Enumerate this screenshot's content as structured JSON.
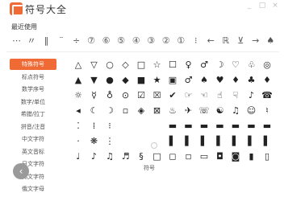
{
  "window": {
    "title": "符号大全",
    "controls": [
      "_",
      "□",
      "×"
    ]
  },
  "recent": {
    "title": "最近使用",
    "symbols": [
      "⋯",
      "〃",
      "‖",
      "¨",
      "÷",
      "⑦",
      "⑥",
      "⑤",
      "④",
      "③",
      "②",
      "①",
      "⁝",
      "←",
      "ℝ",
      "⊻",
      "→",
      "♠"
    ]
  },
  "sidebar": {
    "items": [
      {
        "label": "特殊符号",
        "active": true
      },
      {
        "label": "标点符号",
        "active": false
      },
      {
        "label": "数学序号",
        "active": false
      },
      {
        "label": "数字/单位",
        "active": false
      },
      {
        "label": "希腊/拉丁",
        "active": false
      },
      {
        "label": "拼音/注音",
        "active": false
      },
      {
        "label": "中文字符",
        "active": false
      },
      {
        "label": "英文音标",
        "active": false
      },
      {
        "label": "日文字符",
        "active": false
      },
      {
        "label": "韩文字符",
        "active": false
      },
      {
        "label": "俄文字母",
        "active": false
      }
    ]
  },
  "symbols": {
    "rows": [
      [
        "△",
        "▽",
        "○",
        "◇",
        "□",
        "☆",
        "☐",
        "♀",
        "♂",
        "☽",
        "♡",
        "♧",
        "◎"
      ],
      [
        "▲",
        "▼",
        "●",
        "◆",
        "■",
        "★",
        "▣",
        "♂",
        "♠",
        "♥",
        "♦",
        "♣",
        "♦"
      ],
      [
        "☼",
        "☿",
        "♁",
        "⊙",
        "☑",
        "☒",
        "✔",
        "☞",
        "☜",
        "☝",
        "☟",
        "♪",
        "☎"
      ],
      [
        "◂",
        "☾",
        "☽",
        "▫",
        "◈",
        "⊠",
        "♨",
        "✈",
        "☏",
        "☯",
        "♫",
        "☺",
        "♮"
      ],
      [
        "⁚",
        "⁞",
        "⁝",
        "",
        "",
        "",
        "▬",
        "▬",
        "▬",
        "▬",
        "▬",
        "▬",
        "▬"
      ],
      [
        "·",
        "❋",
        "⋮",
        "",
        "",
        "",
        "▌",
        "▌",
        "▌",
        "▌",
        "▌",
        "▌",
        "▌"
      ],
      [
        "♩",
        "♪",
        "♫",
        "♬",
        "§",
        "□",
        "◻",
        "◽",
        "▭",
        "◘",
        "◙",
        "▮",
        "▯"
      ],
      [
        "",
        "",
        "",
        "",
        "",
        "",
        "",
        "",
        "",
        "",
        "",
        "",
        ""
      ]
    ]
  },
  "hint": {
    "label": "符号"
  },
  "back_button": {
    "label": "‹"
  }
}
